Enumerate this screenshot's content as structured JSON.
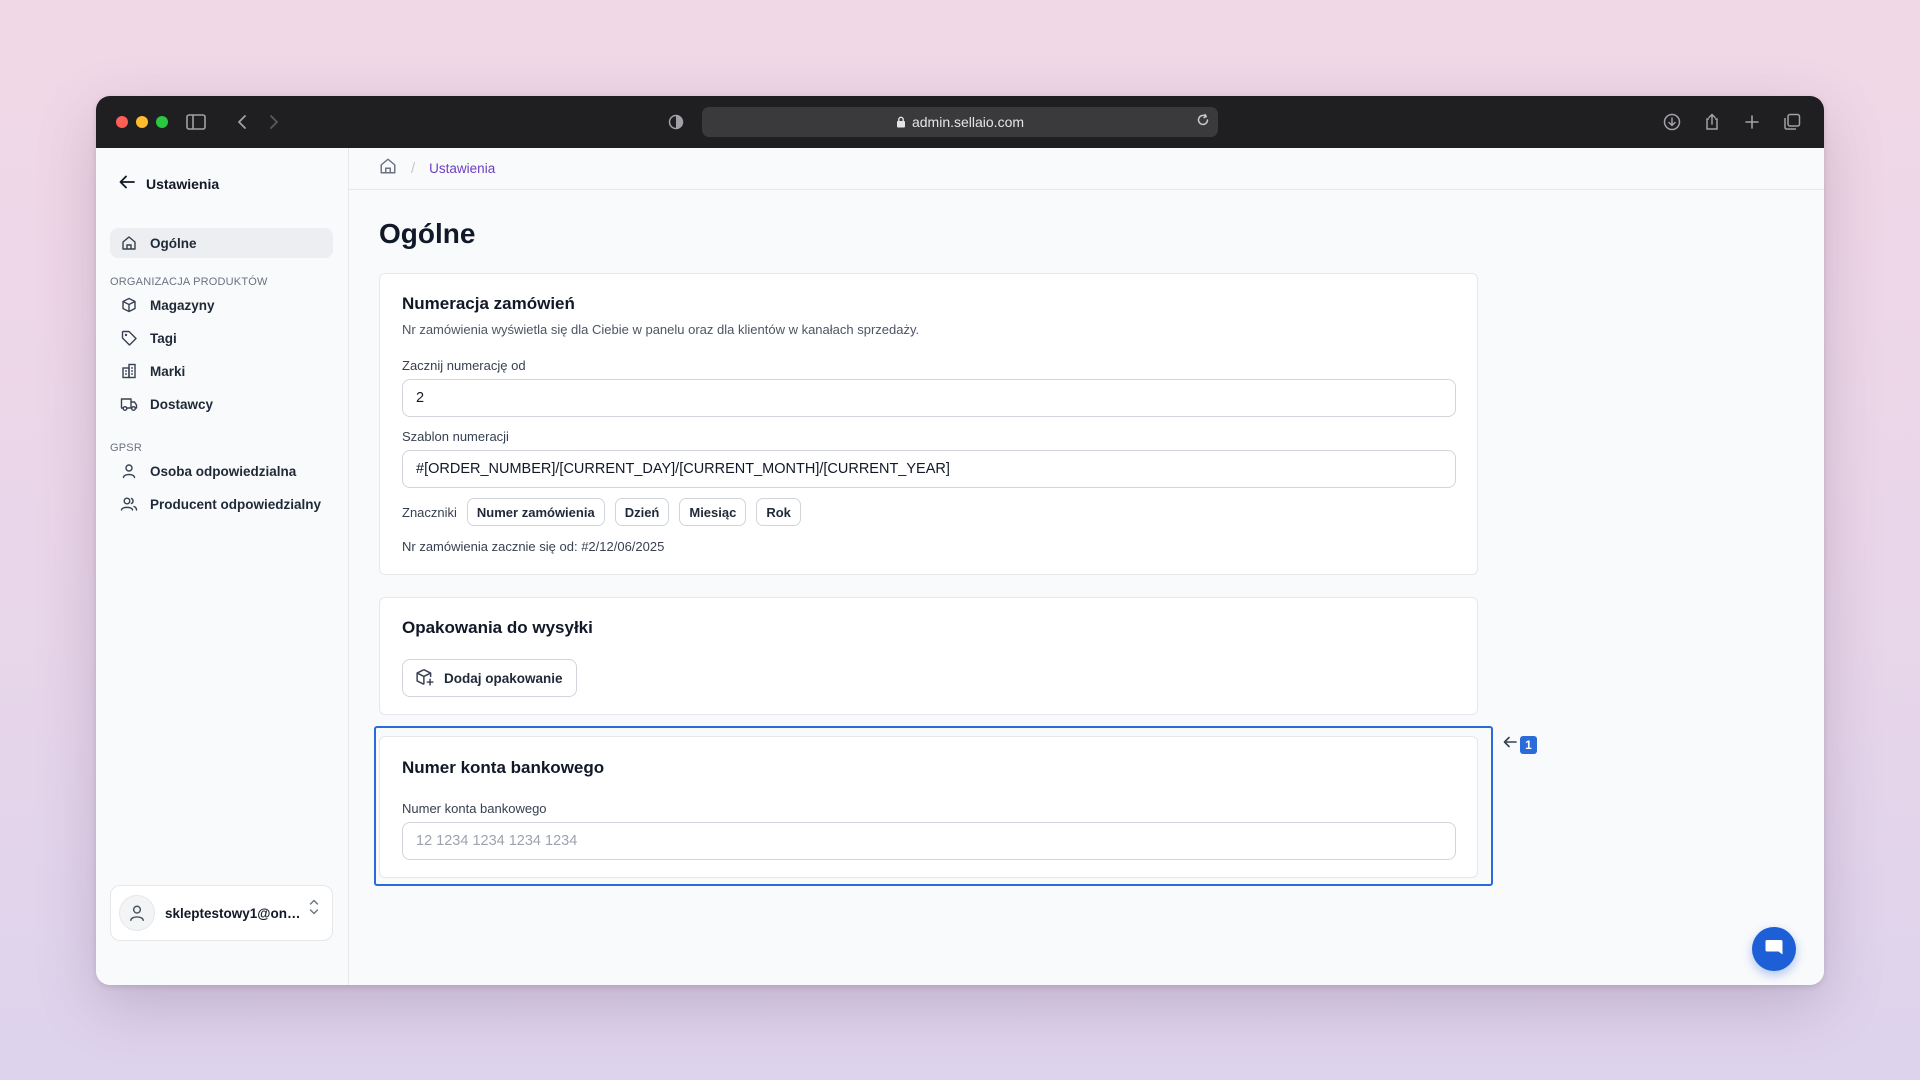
{
  "browser": {
    "url": "admin.sellaio.com"
  },
  "sidebar": {
    "back_label": "Ustawienia",
    "items": [
      {
        "label": "Ogólne",
        "icon": "home-icon",
        "active": true
      }
    ],
    "section_products": {
      "title": "ORGANIZACJA PRODUKTÓW",
      "items": [
        {
          "label": "Magazyny",
          "icon": "box-icon"
        },
        {
          "label": "Tagi",
          "icon": "tag-icon"
        },
        {
          "label": "Marki",
          "icon": "building-icon"
        },
        {
          "label": "Dostawcy",
          "icon": "truck-icon"
        }
      ]
    },
    "section_gpsr": {
      "title": "GPSR",
      "items": [
        {
          "label": "Osoba odpowiedzialna",
          "icon": "user-icon"
        },
        {
          "label": "Producent odpowiedzialny",
          "icon": "users-icon"
        }
      ]
    },
    "account": {
      "email": "skleptestowy1@onet.pl"
    }
  },
  "breadcrumb": {
    "current": "Ustawienia"
  },
  "page": {
    "title": "Ogólne"
  },
  "order_numbering": {
    "title": "Numeracja zamówień",
    "description": "Nr zamówienia wyświetla się dla Ciebie w panelu oraz dla klientów w kanałach sprzedaży.",
    "start_label": "Zacznij numerację od",
    "start_value": "2",
    "template_label": "Szablon numeracji",
    "template_value": "#[ORDER_NUMBER]/[CURRENT_DAY]/[CURRENT_MONTH]/[CURRENT_YEAR]",
    "tags_label": "Znaczniki",
    "tags": [
      "Numer zamówienia",
      "Dzień",
      "Miesiąc",
      "Rok"
    ],
    "preview_text": "Nr zamówienia zacznie się od:",
    "preview_value": "#2/12/06/2025"
  },
  "packaging": {
    "title": "Opakowania do wysyłki",
    "add_button": "Dodaj opakowanie"
  },
  "bank_account": {
    "title": "Numer konta bankowego",
    "field_label": "Numer konta bankowego",
    "placeholder": "12 1234 1234 1234 1234"
  },
  "annotation": {
    "marker_number": "1"
  },
  "colors": {
    "accent": "#6d3fc0",
    "highlight": "#2b6bd9",
    "chat": "#1d5fd6"
  }
}
